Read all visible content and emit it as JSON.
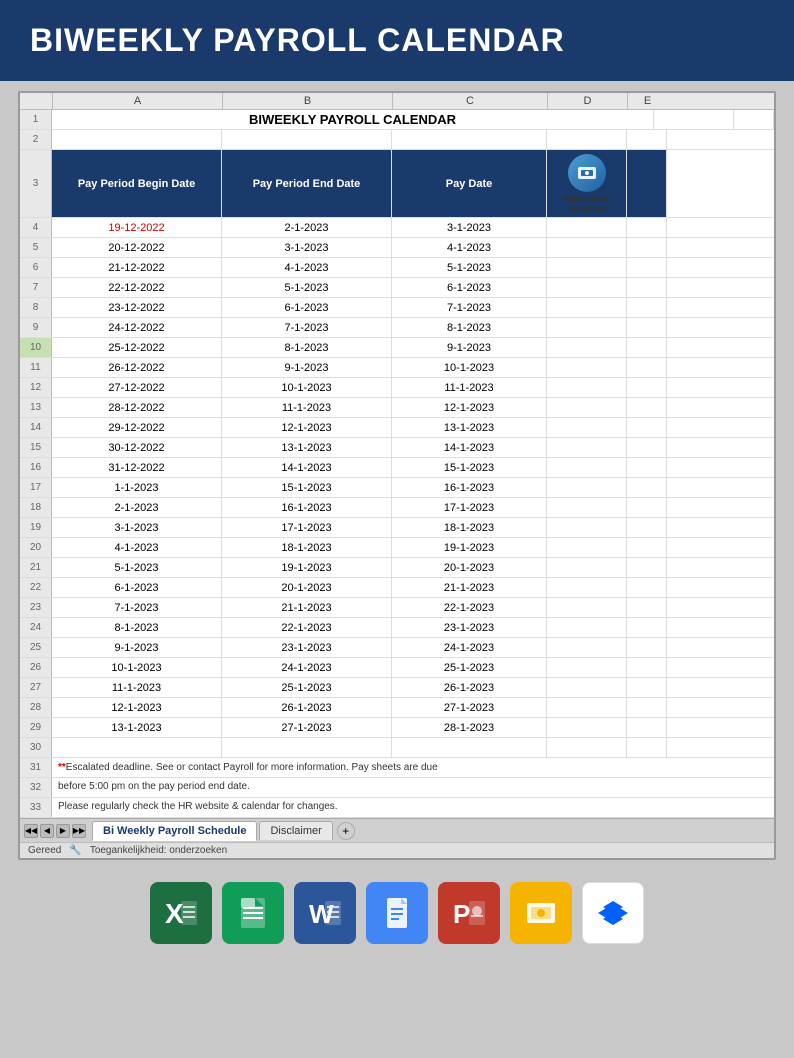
{
  "banner": {
    "title": "BIWEEKLY PAYROLL CALENDAR"
  },
  "spreadsheet": {
    "title": "BIWEEKLY PAYROLL CALENDAR",
    "col_headers": [
      "",
      "A",
      "B",
      "C",
      "D",
      "E"
    ],
    "headers": [
      "Pay Period Begin Date",
      "Pay Period End Date",
      "Pay Date"
    ],
    "rows": [
      {
        "num": "4",
        "a": "19-12-2022",
        "b": "2-1-2023",
        "c": "3-1-2023",
        "red": true
      },
      {
        "num": "5",
        "a": "20-12-2022",
        "b": "3-1-2023",
        "c": "4-1-2023"
      },
      {
        "num": "6",
        "a": "21-12-2022",
        "b": "4-1-2023",
        "c": "5-1-2023"
      },
      {
        "num": "7",
        "a": "22-12-2022",
        "b": "5-1-2023",
        "c": "6-1-2023"
      },
      {
        "num": "8",
        "a": "23-12-2022",
        "b": "6-1-2023",
        "c": "7-1-2023"
      },
      {
        "num": "9",
        "a": "24-12-2022",
        "b": "7-1-2023",
        "c": "8-1-2023"
      },
      {
        "num": "10",
        "a": "25-12-2022",
        "b": "8-1-2023",
        "c": "9-1-2023",
        "highlight": true
      },
      {
        "num": "11",
        "a": "26-12-2022",
        "b": "9-1-2023",
        "c": "10-1-2023"
      },
      {
        "num": "12",
        "a": "27-12-2022",
        "b": "10-1-2023",
        "c": "11-1-2023"
      },
      {
        "num": "13",
        "a": "28-12-2022",
        "b": "11-1-2023",
        "c": "12-1-2023"
      },
      {
        "num": "14",
        "a": "29-12-2022",
        "b": "12-1-2023",
        "c": "13-1-2023"
      },
      {
        "num": "15",
        "a": "30-12-2022",
        "b": "13-1-2023",
        "c": "14-1-2023"
      },
      {
        "num": "16",
        "a": "31-12-2022",
        "b": "14-1-2023",
        "c": "15-1-2023"
      },
      {
        "num": "17",
        "a": "1-1-2023",
        "b": "15-1-2023",
        "c": "16-1-2023"
      },
      {
        "num": "18",
        "a": "2-1-2023",
        "b": "16-1-2023",
        "c": "17-1-2023"
      },
      {
        "num": "19",
        "a": "3-1-2023",
        "b": "17-1-2023",
        "c": "18-1-2023"
      },
      {
        "num": "20",
        "a": "4-1-2023",
        "b": "18-1-2023",
        "c": "19-1-2023"
      },
      {
        "num": "21",
        "a": "5-1-2023",
        "b": "19-1-2023",
        "c": "20-1-2023"
      },
      {
        "num": "22",
        "a": "6-1-2023",
        "b": "20-1-2023",
        "c": "21-1-2023"
      },
      {
        "num": "23",
        "a": "7-1-2023",
        "b": "21-1-2023",
        "c": "22-1-2023"
      },
      {
        "num": "24",
        "a": "8-1-2023",
        "b": "22-1-2023",
        "c": "23-1-2023"
      },
      {
        "num": "25",
        "a": "9-1-2023",
        "b": "23-1-2023",
        "c": "24-1-2023"
      },
      {
        "num": "26",
        "a": "10-1-2023",
        "b": "24-1-2023",
        "c": "25-1-2023"
      },
      {
        "num": "27",
        "a": "11-1-2023",
        "b": "25-1-2023",
        "c": "26-1-2023"
      },
      {
        "num": "28",
        "a": "12-1-2023",
        "b": "26-1-2023",
        "c": "27-1-2023"
      },
      {
        "num": "29",
        "a": "13-1-2023",
        "b": "27-1-2023",
        "c": "28-1-2023"
      }
    ],
    "footer_notes": [
      "** Escalated deadline. See  or contact Payroll for more information. Pay sheets are due",
      "before 5:00 pm on the pay period end date.",
      "Please regularly check the HR website & calendar for changes."
    ],
    "logo_text": "AllBusiness\nTemplates",
    "tabs": [
      "Bi Weekly Payroll Schedule",
      "Disclaimer"
    ],
    "active_tab": "Bi Weekly Payroll Schedule",
    "status": "Gereed",
    "accessibility": "Toegankelijkheid: onderzoeken"
  },
  "app_icons": [
    {
      "name": "Excel",
      "type": "excel"
    },
    {
      "name": "Google Sheets",
      "type": "sheets"
    },
    {
      "name": "Word",
      "type": "word"
    },
    {
      "name": "Google Docs",
      "type": "docs"
    },
    {
      "name": "PowerPoint",
      "type": "ppt"
    },
    {
      "name": "Google Slides",
      "type": "slides"
    },
    {
      "name": "Dropbox",
      "type": "dropbox"
    }
  ]
}
